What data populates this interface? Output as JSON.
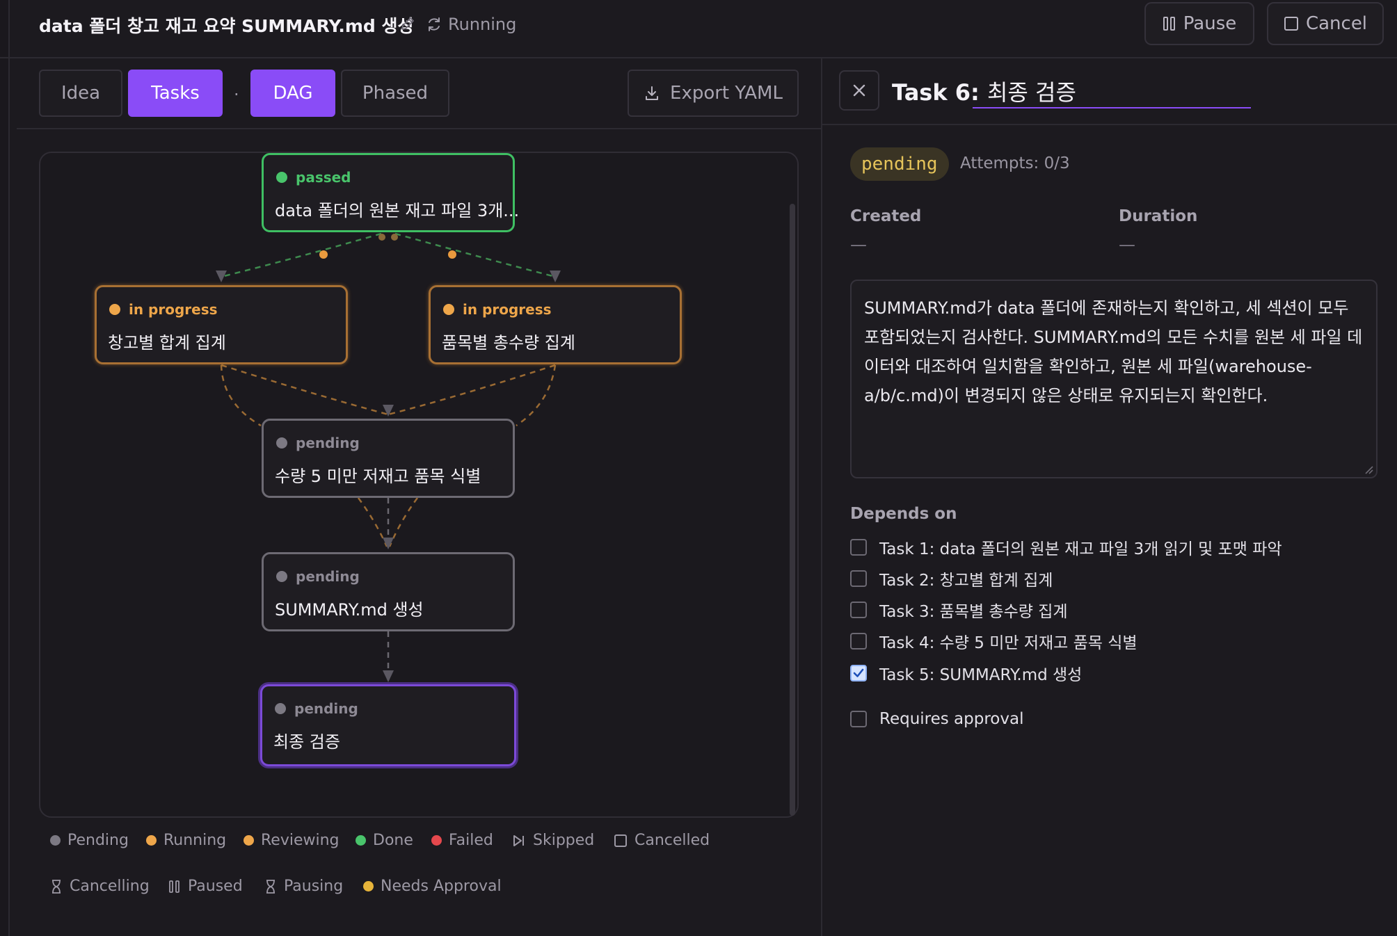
{
  "header": {
    "title": "data 폴더 창고 재고 요약 SUMMARY.md 생성",
    "status": "Running",
    "pause_label": "Pause",
    "cancel_label": "Cancel"
  },
  "toolbar": {
    "tabs": [
      "Idea",
      "Tasks",
      "DAG",
      "Phased"
    ],
    "separator": "·",
    "export_label": "Export YAML"
  },
  "dag": {
    "nodes": [
      {
        "status": "passed",
        "name": "data 폴더의 원본 재고 파일 3개..."
      },
      {
        "status": "in progress",
        "name": "창고별 합계 집계"
      },
      {
        "status": "in progress",
        "name": "품목별 총수량 집계"
      },
      {
        "status": "pending",
        "name": "수량 5 미만 저재고 품목 식별"
      },
      {
        "status": "pending",
        "name": "SUMMARY.md 생성"
      },
      {
        "status": "pending",
        "name": "최종 검증"
      }
    ]
  },
  "legend": [
    {
      "label": "Pending",
      "icon": "dot",
      "color": "#7c7983"
    },
    {
      "label": "Running",
      "icon": "dot",
      "color": "#eea64a"
    },
    {
      "label": "Reviewing",
      "icon": "dot",
      "color": "#eea64a"
    },
    {
      "label": "Done",
      "icon": "dot",
      "color": "#49c46b"
    },
    {
      "label": "Failed",
      "icon": "dot",
      "color": "#e5484d"
    },
    {
      "label": "Skipped",
      "icon": "skip-icon",
      "color": "#9d99a5"
    },
    {
      "label": "Cancelled",
      "icon": "square-icon",
      "color": "#9d99a5"
    },
    {
      "label": "Cancelling",
      "icon": "hourglass-icon",
      "color": "#9d99a5"
    },
    {
      "label": "Paused",
      "icon": "pause-icon",
      "color": "#9d99a5"
    },
    {
      "label": "Pausing",
      "icon": "hourglass-icon",
      "color": "#9d99a5"
    },
    {
      "label": "Needs Approval",
      "icon": "dot",
      "color": "#e6b43a"
    }
  ],
  "detail": {
    "task_prefix": "Task 6:",
    "task_name": "최종 검증",
    "status_badge": "pending",
    "attempts": "Attempts: 0/3",
    "created_label": "Created",
    "created_value": "—",
    "duration_label": "Duration",
    "duration_value": "—",
    "description": "SUMMARY.md가 data 폴더에 존재하는지 확인하고, 세 섹션이 모두 포함되었는지 검사한다. SUMMARY.md의 모든 수치를 원본 세 파일 데이터와 대조하여 일치함을 확인하고, 원본 세 파일(warehouse-a/b/c.md)이 변경되지 않은 상태로 유지되는지 확인한다.",
    "depends_label": "Depends on",
    "depends": [
      {
        "label": "Task 1: data 폴더의 원본 재고 파일 3개 읽기 및 포맷 파악",
        "checked": false
      },
      {
        "label": "Task 2: 창고별 합계 집계",
        "checked": false
      },
      {
        "label": "Task 3: 품목별 총수량 집계",
        "checked": false
      },
      {
        "label": "Task 4: 수량 5 미만 저재고 품목 식별",
        "checked": false
      },
      {
        "label": "Task 5: SUMMARY.md 생성",
        "checked": true
      }
    ],
    "requires_approval_label": "Requires approval",
    "requires_approval": false
  }
}
